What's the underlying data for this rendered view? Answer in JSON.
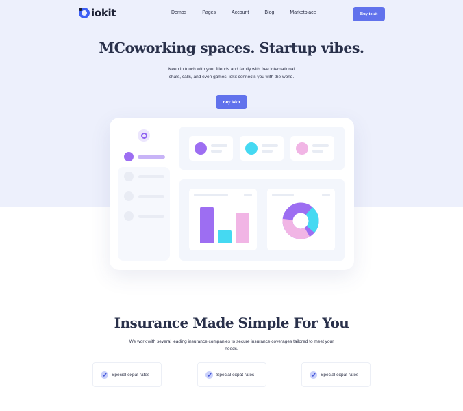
{
  "brand": {
    "logo_text": "iokit",
    "accent": "#6172ec",
    "logo_ring": "#3d5ff5"
  },
  "nav": {
    "links": [
      "Demos",
      "Pages",
      "Account",
      "Blog",
      "Marketplace"
    ],
    "cta_label": "Buy iokit"
  },
  "hero": {
    "title": "MCoworking spaces. Startup vibes.",
    "subtitle": "Keep in touch with your friends and family with free international chats, calls, and even games. iokit connects you with the world.",
    "cta_label": "Buy iokit",
    "background": "#edf0fc"
  },
  "dashboard": {
    "logo_icon": "dashboard-logo-icon",
    "stat_colors": [
      "#9d6ef2",
      "#45d9f2",
      "#f1b5e5"
    ],
    "bar_chart": {
      "values": [
        100,
        38,
        84
      ],
      "colors": [
        "#9d6ef2",
        "#45d9f2",
        "#f1b5e5"
      ]
    },
    "donut_colors": [
      "#9d6ef2",
      "#f1b5e5",
      "#45d9f2"
    ]
  },
  "insurance": {
    "title": "Insurance Made Simple For You",
    "subtitle": "We work with several leading insurance companies to secure insurance coverages tailored to meet your needs.",
    "features": [
      {
        "label": "Special expat rates",
        "icon": "check-icon"
      },
      {
        "label": "Special expat rates",
        "icon": "check-icon"
      },
      {
        "label": "Special expat rates",
        "icon": "check-icon"
      }
    ]
  }
}
